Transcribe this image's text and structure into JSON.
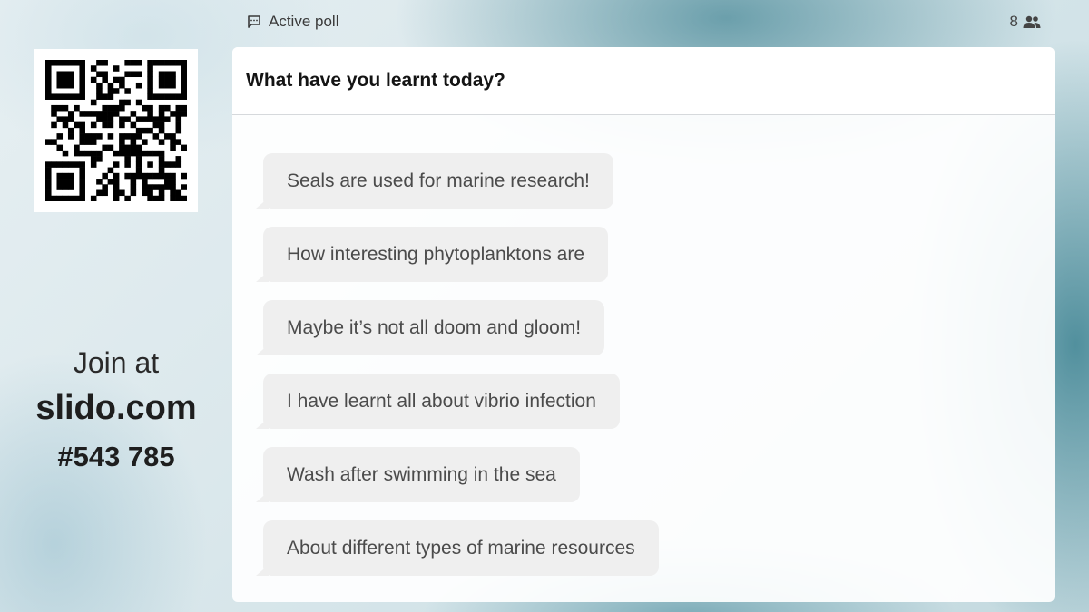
{
  "topbar": {
    "poll_status": "Active poll",
    "participant_count": "8",
    "status_icon": "chat-bubble-icon",
    "participants_icon": "people-icon"
  },
  "join": {
    "label": "Join at",
    "domain": "slido.com",
    "code": "#543 785"
  },
  "question": {
    "title": "What have you learnt today?"
  },
  "answers": [
    "Seals are used for marine research!",
    "How interesting phytoplanktons are",
    "Maybe it’s not all doom and gloom!",
    "I have learnt all about vibrio infection",
    "Wash after swimming in the sea",
    "About different types of marine resources"
  ],
  "colors": {
    "bubble": "#efefef",
    "panel": "#ffffff",
    "text": "#4b4b4b"
  }
}
